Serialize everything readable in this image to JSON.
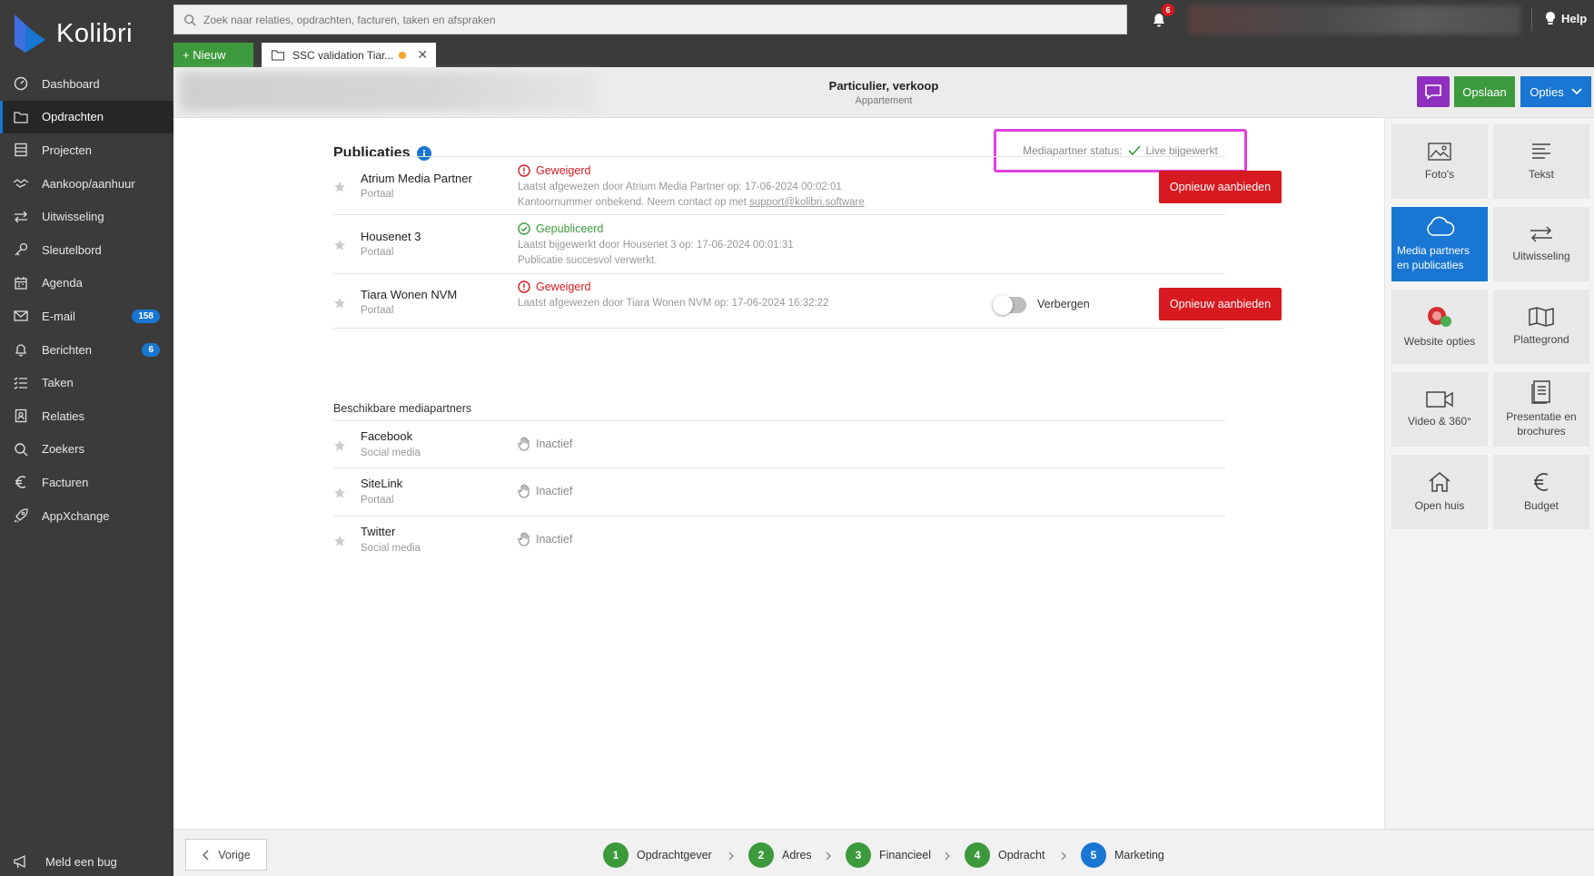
{
  "app": {
    "name": "Kolibri"
  },
  "sidebar": {
    "items": [
      {
        "label": "Dashboard",
        "icon": "dashboard-icon"
      },
      {
        "label": "Opdrachten",
        "icon": "folder-icon",
        "active": true
      },
      {
        "label": "Projecten",
        "icon": "projects-icon"
      },
      {
        "label": "Aankoop/aanhuur",
        "icon": "handshake-icon"
      },
      {
        "label": "Uitwisseling",
        "icon": "exchange-icon"
      },
      {
        "label": "Sleutelbord",
        "icon": "key-icon"
      },
      {
        "label": "Agenda",
        "icon": "calendar-icon"
      },
      {
        "label": "E-mail",
        "icon": "mail-icon",
        "badge": "158"
      },
      {
        "label": "Berichten",
        "icon": "bell-icon",
        "badge": "6"
      },
      {
        "label": "Taken",
        "icon": "tasks-icon"
      },
      {
        "label": "Relaties",
        "icon": "contacts-icon"
      },
      {
        "label": "Zoekers",
        "icon": "search-icon"
      },
      {
        "label": "Facturen",
        "icon": "euro-icon"
      },
      {
        "label": "AppXchange",
        "icon": "rocket-icon"
      }
    ],
    "bug_label": "Meld een bug"
  },
  "topbar": {
    "search_placeholder": "Zoek naar relaties, opdrachten, facturen, taken en afspraken",
    "notification_count": "6",
    "help_label": "Help"
  },
  "tabs": {
    "new_label": "+ Nieuw",
    "open_tab_label": "SSC validation Tiar..."
  },
  "header": {
    "title": "Particulier, verkoop",
    "subtitle": "Appartement",
    "save_label": "Opslaan",
    "options_label": "Opties"
  },
  "publications": {
    "title": "Publicaties",
    "status_label": "Mediapartner status:",
    "status_value": "Live bijgewerkt",
    "partners": [
      {
        "name": "Atrium Media Partner",
        "type": "Portaal",
        "status": "Geweigerd",
        "line1": "Laatst afgewezen door Atrium Media Partner op: 17-06-2024 00:02:01",
        "line2_prefix": "Kantoornummer onbekend. Neem contact op met ",
        "line2_link": "support@kolibri.software",
        "button": "Opnieuw aanbieden"
      },
      {
        "name": "Housenet 3",
        "type": "Portaal",
        "status": "Gepubliceerd",
        "line1": "Laatst bijgewerkt door Housenet 3 op: 17-06-2024 00:01:31",
        "line2": "Publicatie succesvol verwerkt."
      },
      {
        "name": "Tiara Wonen NVM",
        "type": "Portaal",
        "status": "Geweigerd",
        "line1": "Laatst afgewezen door Tiara Wonen NVM op: 17-06-2024 16:32:22",
        "toggle_label": "Verbergen",
        "button": "Opnieuw aanbieden"
      }
    ],
    "available_title": "Beschikbare mediapartners",
    "available": [
      {
        "name": "Facebook",
        "type": "Social media",
        "status": "Inactief"
      },
      {
        "name": "SiteLink",
        "type": "Portaal",
        "status": "Inactief"
      },
      {
        "name": "Twitter",
        "type": "Social media",
        "status": "Inactief"
      }
    ]
  },
  "right_panel": {
    "tiles": [
      {
        "label": "Foto's",
        "icon": "photo-icon"
      },
      {
        "label": "Tekst",
        "icon": "text-icon"
      },
      {
        "label": "Media partners en publicaties",
        "icon": "cloud-icon",
        "active": true
      },
      {
        "label": "Uitwisseling",
        "icon": "exchange-icon"
      },
      {
        "label": "Website opties",
        "icon": "website-icon"
      },
      {
        "label": "Plattegrond",
        "icon": "map-icon"
      },
      {
        "label": "Video & 360°",
        "icon": "video-icon"
      },
      {
        "label": "Presentatie en brochures",
        "icon": "brochure-icon"
      },
      {
        "label": "Open huis",
        "icon": "house-icon"
      },
      {
        "label": "Budget",
        "icon": "euro-icon"
      }
    ]
  },
  "footer": {
    "prev_label": "Vorige",
    "steps": [
      {
        "num": "1",
        "label": "Opdrachtgever"
      },
      {
        "num": "2",
        "label": "Adres"
      },
      {
        "num": "3",
        "label": "Financieel"
      },
      {
        "num": "4",
        "label": "Opdracht"
      },
      {
        "num": "5",
        "label": "Marketing"
      }
    ]
  },
  "colors": {
    "sidebar_bg": "#3b3b3b",
    "accent_blue": "#1976d2",
    "green": "#3c9a3c",
    "red": "#d71920",
    "purple": "#8e2fbf",
    "highlight": "#e040e0"
  }
}
